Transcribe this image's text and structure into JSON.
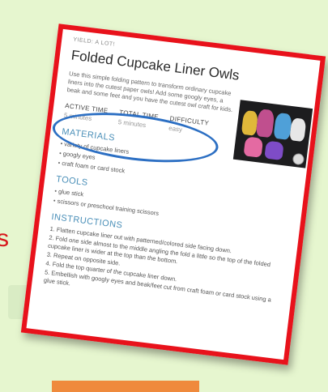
{
  "side_text": "s",
  "recipe": {
    "yield": "YIELD: A LOT!",
    "title": "Folded Cupcake Liner Owls",
    "description": "Use this simple folding pattern to transform ordinary cupcake liners into the cutest paper owls! Add some googly eyes, a beak and some feet and you have the cutest owl craft for kids.",
    "times": [
      {
        "label": "ACTIVE TIME",
        "value": "5 minutes"
      },
      {
        "label": "TOTAL TIME",
        "value": "5 minutes"
      },
      {
        "label": "DIFFICULTY",
        "value": "easy"
      }
    ],
    "materials_heading": "MATERIALS",
    "materials": [
      "variety of cupcake liners",
      "googly eyes",
      "craft foam or card stock"
    ],
    "tools_heading": "TOOLS",
    "tools": [
      "glue stick",
      "scissors or preschool training scissors"
    ],
    "instructions_heading": "INSTRUCTIONS",
    "instructions": [
      "1. Flatten cupcake liner out with patterned/colored side facing down.",
      "2. Fold one side almost to the middle angling the fold a little so the top of the folded cupcake liner is wider at the top than the bottom.",
      "3. Repeat on opposite side.",
      "4. Fold the top quarter of the cupcake liner down.",
      "5. Embellish with googly eyes and beak/feet cut from craft foam or card stock using a glue stick."
    ]
  },
  "colors": {
    "annotation_border": "#e8121b",
    "highlight_ellipse": "#2c6fc3",
    "section_heading": "#4a8fb8",
    "background": "#e6f6cf"
  }
}
